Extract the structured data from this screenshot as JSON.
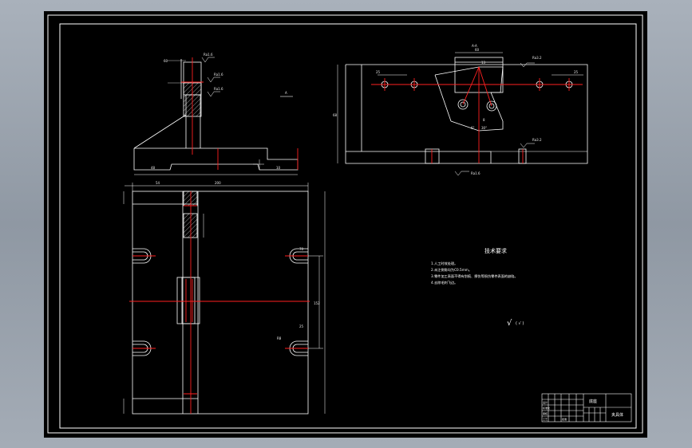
{
  "colors": {
    "background": "#000000",
    "outline": "#ffffff",
    "centerline": "#ff2020",
    "hatch": "#ffffff",
    "chrome": "#99a1ab"
  },
  "views": {
    "top_view": {
      "section_label": "A",
      "roughness_labels": [
        "Ra1.6",
        "Ra1.6",
        "Ra1.6"
      ],
      "dims": [
        "48",
        "60",
        "10"
      ]
    },
    "section_view": {
      "title": "A-A",
      "roughness_labels": [
        "Ra3.2",
        "Ra1.6",
        "Ra3.2"
      ],
      "dims": [
        "60",
        "25",
        "25",
        "13",
        "8",
        "68",
        "6°",
        "30°"
      ]
    },
    "plan_view": {
      "dims": [
        "54",
        "200",
        "152",
        "70",
        "R8",
        "25"
      ]
    }
  },
  "notes": {
    "title": "技术要求",
    "items": [
      "1.人工时效处理。",
      "2.未注倒角均为C0.5mm。",
      "3.零件加工表面不得有划痕、擦伤等损伤零件表面的缺陷。",
      "4.去除毛刺飞边。"
    ],
    "roughness_symbol": "√",
    "roughness_paren": "( √ )"
  },
  "title_block": {
    "drawing_name": "底座",
    "part_code": "夹具体",
    "grid_labels": [
      "设计",
      "标准化",
      "审核",
      "工艺",
      "批准"
    ]
  }
}
